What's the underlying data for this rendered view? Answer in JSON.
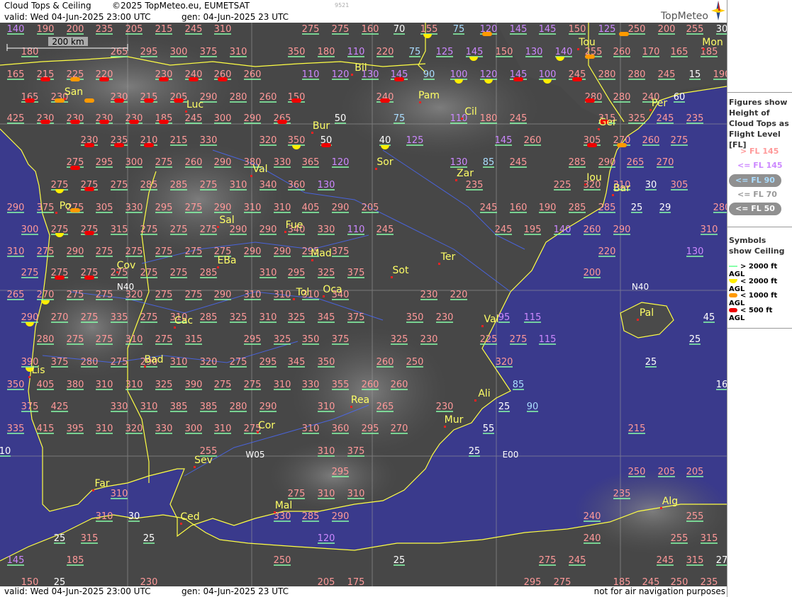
{
  "header": {
    "title": "Cloud Tops & Ceiling",
    "copyright": "©2025 TopMeteo.eu, EUMETSAT",
    "valid": "valid:  Wed  04-Jun-2025  23:00 UTC",
    "generated": "gen:  04-Jun-2025 23 UTC",
    "code": "9521",
    "logo_text": "TopMeteo"
  },
  "footer": {
    "valid": "valid:  Wed  04-Jun-2025  23:00 UTC",
    "generated": "gen:  04-Jun-2025 23 UTC",
    "disclaimer": "not for air navigation purposes"
  },
  "scale_label": "200 km",
  "legend": {
    "heading": "Figures show Height of Cloud Tops as Flight Level  [FL]",
    "levels": [
      {
        "label": "> FL 145",
        "color": "#ff9999",
        "style": "text"
      },
      {
        "label": "<= FL 145",
        "color": "#cc88ff",
        "style": "text"
      },
      {
        "label": "<= FL 90",
        "color": "#aaddff",
        "style": "pill"
      },
      {
        "label": "<= FL 70",
        "color": "#dddddd",
        "style": "text"
      },
      {
        "label": "<= FL 50",
        "color": "#ffffff",
        "style": "pill"
      }
    ],
    "symbols_heading": "Symbols show Ceiling",
    "symbols": [
      {
        "label": "> 2000 ft AGL",
        "color": "#88ffaa",
        "shape": "line"
      },
      {
        "label": "< 2000 ft AGL",
        "color": "#ffee00",
        "shape": "half"
      },
      {
        "label": "< 1000 ft AGL",
        "color": "#ff9900",
        "shape": "bar"
      },
      {
        "label": "< 500 ft AGL",
        "color": "#ee0000",
        "shape": "bar"
      }
    ]
  },
  "grid_labels": [
    "N40",
    "N40",
    "W05",
    "E00"
  ],
  "cities": [
    "Bil",
    "San",
    "Luc",
    "Pam",
    "Per",
    "Tou",
    "Mon",
    "Cil",
    "Bur",
    "Sor",
    "Zar",
    "Iou",
    "Ger",
    "Bar",
    "Val",
    "Po",
    "Sal",
    "Fue",
    "Mad",
    "Ter",
    "Cov",
    "EBa",
    "Sot",
    "Tol",
    "Oca",
    "Cac",
    "Val",
    "Pal",
    "Bad",
    "Lis",
    "Rea",
    "Ali",
    "Mur",
    "Cor",
    "Sev",
    "Far",
    "Ced",
    "Mal",
    "Alg"
  ],
  "colors": {
    "high": "#ff9999",
    "mid": "#cc88ff",
    "low": "#aaddff",
    "lower": "#dddddd",
    "lowest": "#ffffff",
    "city": "#ffff66",
    "sea": "#3a3a8c",
    "coast": "#ffff44"
  },
  "figures": {
    "h": [
      "140",
      "190",
      "200",
      "235",
      "205",
      "215",
      "245",
      "310",
      "275",
      "275",
      "160",
      "70",
      "155",
      "75",
      "120",
      "145",
      "145",
      "150",
      "125",
      "250",
      "200",
      "255",
      "30",
      "180",
      "265",
      "295",
      "300",
      "375",
      "310",
      "350",
      "180",
      "110",
      "220",
      "75",
      "125",
      "145",
      "150",
      "130",
      "140",
      "255",
      "260",
      "170",
      "165",
      "185",
      "165",
      "215",
      "225",
      "220",
      "230",
      "240",
      "260",
      "260",
      "110",
      "120",
      "130",
      "145",
      "90",
      "100",
      "120",
      "145",
      "100",
      "245",
      "280",
      "280",
      "245",
      "15",
      "190",
      "165",
      "230",
      "230",
      "215",
      "205",
      "290",
      "280",
      "260",
      "150",
      "240",
      "280",
      "280",
      "240",
      "60",
      "425",
      "230",
      "230",
      "230",
      "230",
      "185",
      "245",
      "300",
      "290",
      "265",
      "50",
      "75",
      "110",
      "180",
      "245",
      "315",
      "325",
      "245",
      "235",
      "230",
      "235",
      "210",
      "215",
      "330",
      "320",
      "350",
      "50",
      "40",
      "125",
      "145",
      "260",
      "305",
      "270",
      "260",
      "275",
      "275",
      "295",
      "300",
      "275",
      "260",
      "290",
      "380",
      "330",
      "365",
      "120",
      "130",
      "85",
      "245",
      "285",
      "290",
      "265",
      "270",
      "275",
      "275",
      "275",
      "285",
      "285",
      "275",
      "310",
      "340",
      "360",
      "130",
      "235",
      "225",
      "320",
      "310",
      "30",
      "305",
      "290",
      "375",
      "275",
      "305",
      "330",
      "295",
      "275",
      "290",
      "310",
      "310",
      "405",
      "290",
      "205",
      "245",
      "160",
      "190",
      "285",
      "285",
      "25",
      "29",
      "280",
      "300",
      "275",
      "275",
      "315",
      "275",
      "275",
      "275",
      "290",
      "290",
      "340",
      "330",
      "110",
      "245",
      "245",
      "195",
      "140",
      "260",
      "290",
      "310",
      "310",
      "275",
      "290",
      "275",
      "275",
      "275",
      "275",
      "275",
      "290",
      "290",
      "295",
      "375",
      "220",
      "130",
      "275",
      "275",
      "275",
      "275",
      "275",
      "275",
      "285",
      "310",
      "295",
      "325",
      "375",
      "200",
      "265",
      "270",
      "275",
      "275",
      "320",
      "275",
      "275",
      "290",
      "310",
      "310",
      "310",
      "340",
      "230",
      "220",
      "290",
      "270",
      "275",
      "335",
      "275",
      "310",
      "285",
      "325",
      "310",
      "325",
      "345",
      "375",
      "350",
      "230",
      "95",
      "115",
      "45",
      "280",
      "275",
      "275",
      "310",
      "275",
      "315",
      "295",
      "325",
      "350",
      "375",
      "325",
      "230",
      "225",
      "275",
      "115",
      "25",
      "390",
      "375",
      "280",
      "275",
      "290",
      "310",
      "320",
      "275",
      "295",
      "345",
      "350",
      "260",
      "250",
      "320",
      "25",
      "350",
      "405",
      "380",
      "310",
      "310",
      "325",
      "390",
      "275",
      "275",
      "310",
      "330",
      "355",
      "260",
      "260",
      "85",
      "16",
      "375",
      "425",
      "330",
      "310",
      "385",
      "385",
      "280",
      "290",
      "310",
      "265",
      "230",
      "25",
      "90",
      "335",
      "415",
      "395",
      "310",
      "320",
      "330",
      "300",
      "310",
      "275",
      "310",
      "360",
      "295",
      "270",
      "55",
      "215",
      "10",
      "255",
      "310",
      "375",
      "25",
      "295",
      "250",
      "205",
      "205",
      "310",
      "275",
      "310",
      "310",
      "235",
      "310",
      "30",
      "330",
      "285",
      "290",
      "240",
      "255",
      "25",
      "315",
      "25",
      "120",
      "240",
      "255",
      "315",
      "145",
      "185",
      "250",
      "25",
      "275",
      "245",
      "245",
      "315",
      "27",
      "150",
      "25",
      "230",
      "205",
      "175",
      "295",
      "275",
      "185",
      "245",
      "250",
      "235"
    ]
  }
}
